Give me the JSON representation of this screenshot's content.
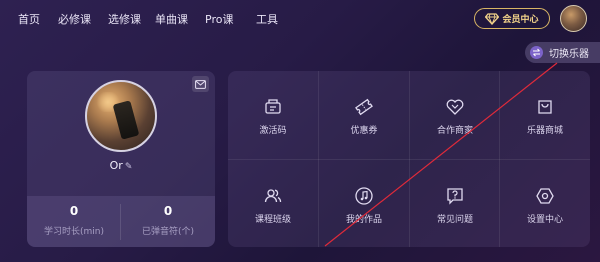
{
  "nav": {
    "items": [
      {
        "label": "首页"
      },
      {
        "label": "必修课"
      },
      {
        "label": "选修课"
      },
      {
        "label": "单曲课"
      },
      {
        "label": "Pro课"
      },
      {
        "label": "工具"
      }
    ],
    "vip_label": "会员中心"
  },
  "switch_instrument": {
    "label": "切换乐器"
  },
  "profile": {
    "username": "Or",
    "stats": [
      {
        "value": "0",
        "label": "学习时长(min)"
      },
      {
        "value": "0",
        "label": "已弹音符(个)"
      }
    ]
  },
  "grid": {
    "items": [
      {
        "label": "激活码",
        "icon": "activation-code-icon"
      },
      {
        "label": "优惠券",
        "icon": "coupon-icon"
      },
      {
        "label": "合作商家",
        "icon": "partner-handshake-icon"
      },
      {
        "label": "乐器商城",
        "icon": "instrument-store-icon"
      },
      {
        "label": "课程班级",
        "icon": "course-class-icon"
      },
      {
        "label": "我的作品",
        "icon": "my-works-music-icon"
      },
      {
        "label": "常见问题",
        "icon": "faq-icon"
      },
      {
        "label": "设置中心",
        "icon": "settings-icon"
      }
    ]
  },
  "colors": {
    "accent_gold": "#f3d48a",
    "accent_purple": "#7c63c9",
    "annotation_red": "#e02a3a"
  }
}
